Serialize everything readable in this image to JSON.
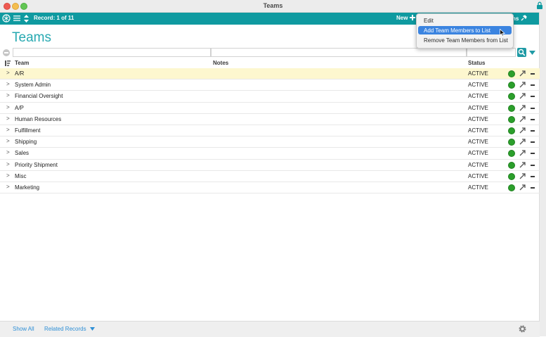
{
  "window": {
    "title": "Teams"
  },
  "toolbar": {
    "record_label": "Record: 1 of 11",
    "new_label": "New",
    "options_label": "ns"
  },
  "page": {
    "title": "Teams"
  },
  "columns": {
    "team": "Team",
    "notes": "Notes",
    "status": "Status"
  },
  "rows": [
    {
      "team": "A/R",
      "status": "ACTIVE"
    },
    {
      "team": "System Admin",
      "status": "ACTIVE"
    },
    {
      "team": "Financial Oversight",
      "status": "ACTIVE"
    },
    {
      "team": "A/P",
      "status": "ACTIVE"
    },
    {
      "team": "Human Resources",
      "status": "ACTIVE"
    },
    {
      "team": "Fulfillment",
      "status": "ACTIVE"
    },
    {
      "team": "Shipping",
      "status": "ACTIVE"
    },
    {
      "team": "Sales",
      "status": "ACTIVE"
    },
    {
      "team": "Priority Shipment",
      "status": "ACTIVE"
    },
    {
      "team": "Misc",
      "status": "ACTIVE"
    },
    {
      "team": "Marketing",
      "status": "ACTIVE"
    }
  ],
  "row_expander": ">",
  "footer": {
    "show_all": "Show All",
    "related_records": "Related Records"
  },
  "menu": {
    "items": [
      "Edit",
      "Add Team Members to List",
      "Remove Team Members from List"
    ],
    "highlighted_index": 1
  },
  "colors": {
    "accent": "#0f9aa0",
    "title": "#27a9b1",
    "status_ok": "#2b9f2b",
    "selection": "#fdf7cf",
    "menu_highlight": "#3b84e0",
    "link": "#2e8fd6"
  }
}
